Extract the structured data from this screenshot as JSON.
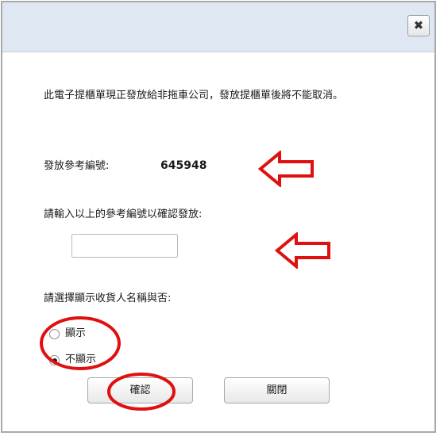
{
  "dialog": {
    "close_glyph": "✖",
    "message": "此電子提櫃單現正發放給非拖車公司，發放提櫃單後將不能取消。",
    "reference_label": "發放參考編號:",
    "reference_value": "645948",
    "input_label": "請輸入以上的參考編號以確認發放:",
    "input_value": "",
    "display_label": "請選擇顯示收貨人名稱與否:",
    "options": [
      {
        "label": "顯示",
        "checked": false
      },
      {
        "label": "不顯示",
        "checked": true
      }
    ],
    "confirm_label": "確認",
    "close_label": "關閉"
  },
  "colors": {
    "titlebar": "#dfe8f2",
    "annotation": "#e01010"
  }
}
